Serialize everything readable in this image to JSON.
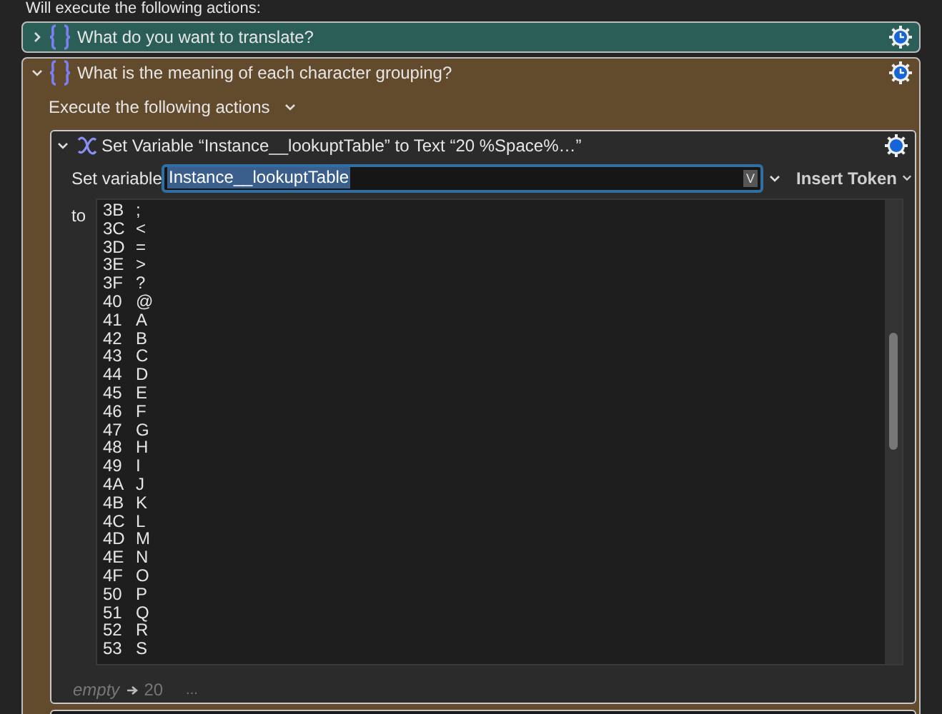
{
  "top_text": "Will execute the following actions:",
  "groups": [
    {
      "title": "What do you want to translate?",
      "expanded": false,
      "color": "#2b5e56"
    },
    {
      "title": "What is the meaning of each character grouping?",
      "expanded": true,
      "color": "#624a2d"
    }
  ],
  "execute_label": "Execute the following actions",
  "action": {
    "title": "Set Variable “Instance__lookuptTable” to Text “20  %Space%…”",
    "expanded": true,
    "set_variable_label": "Set variable",
    "variable_value": "Instance__lookuptTable",
    "variable_badge": "V",
    "insert_token": "Insert Token",
    "to_label": "to",
    "lines": [
      [
        "3B",
        ";"
      ],
      [
        "3C",
        "<"
      ],
      [
        "3D",
        "="
      ],
      [
        "3E",
        ">"
      ],
      [
        "3F",
        "?"
      ],
      [
        "40",
        "@"
      ],
      [
        "41",
        "A"
      ],
      [
        "42",
        "B"
      ],
      [
        "43",
        "C"
      ],
      [
        "44",
        "D"
      ],
      [
        "45",
        "E"
      ],
      [
        "46",
        "F"
      ],
      [
        "47",
        "G"
      ],
      [
        "48",
        "H"
      ],
      [
        "49",
        "I"
      ],
      [
        "4A",
        "J"
      ],
      [
        "4B",
        "K"
      ],
      [
        "4C",
        "L"
      ],
      [
        "4D",
        "M"
      ],
      [
        "4E",
        "N"
      ],
      [
        "4F",
        "O"
      ],
      [
        "50",
        "P"
      ],
      [
        "51",
        "Q"
      ],
      [
        "52",
        "R"
      ],
      [
        "53",
        "S"
      ]
    ],
    "footer_empty": "empty",
    "footer_value": "20",
    "footer_more": "..."
  }
}
